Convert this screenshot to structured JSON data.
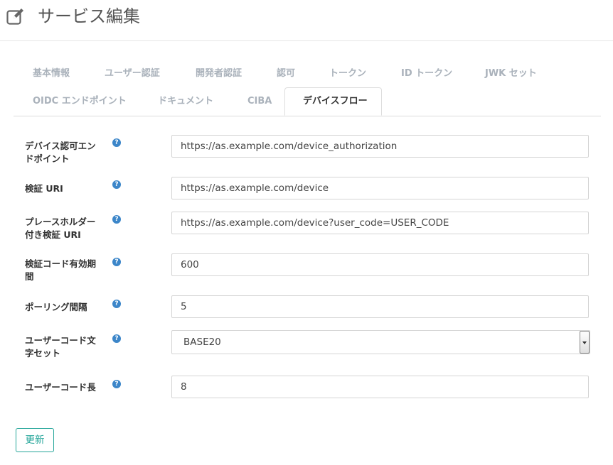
{
  "header": {
    "title": "サービス編集"
  },
  "tabs": [
    {
      "label": "基本情報"
    },
    {
      "label": "ユーザー認証"
    },
    {
      "label": "開発者認証"
    },
    {
      "label": "認可"
    },
    {
      "label": "トークン"
    },
    {
      "label": "ID トークン"
    },
    {
      "label": "JWK セット"
    },
    {
      "label": "OIDC エンドポイント"
    },
    {
      "label": "ドキュメント"
    },
    {
      "label": "CIBA"
    },
    {
      "label": "デバイスフロー",
      "active": true
    }
  ],
  "form": {
    "device_authorization_endpoint": {
      "label": "デバイス認可エンドポイント",
      "value": "https://as.example.com/device_authorization"
    },
    "verification_uri": {
      "label": "検証 URI",
      "value": "https://as.example.com/device"
    },
    "verification_uri_complete": {
      "label": "プレースホルダー付き検証 URI",
      "value": "https://as.example.com/device?user_code=USER_CODE"
    },
    "verification_code_duration": {
      "label": "検証コード有効期間",
      "value": "600"
    },
    "polling_interval": {
      "label": "ポーリング間隔",
      "value": "5"
    },
    "user_code_charset": {
      "label": "ユーザーコード文字セット",
      "value": "BASE20"
    },
    "user_code_length": {
      "label": "ユーザーコード長",
      "value": "8"
    }
  },
  "help_icon_glyph": "?",
  "update_button": {
    "label": "更新"
  },
  "colors": {
    "accent": "#26a69a",
    "help_icon": "#3c86c9",
    "tab_inactive": "#aab2bb"
  }
}
